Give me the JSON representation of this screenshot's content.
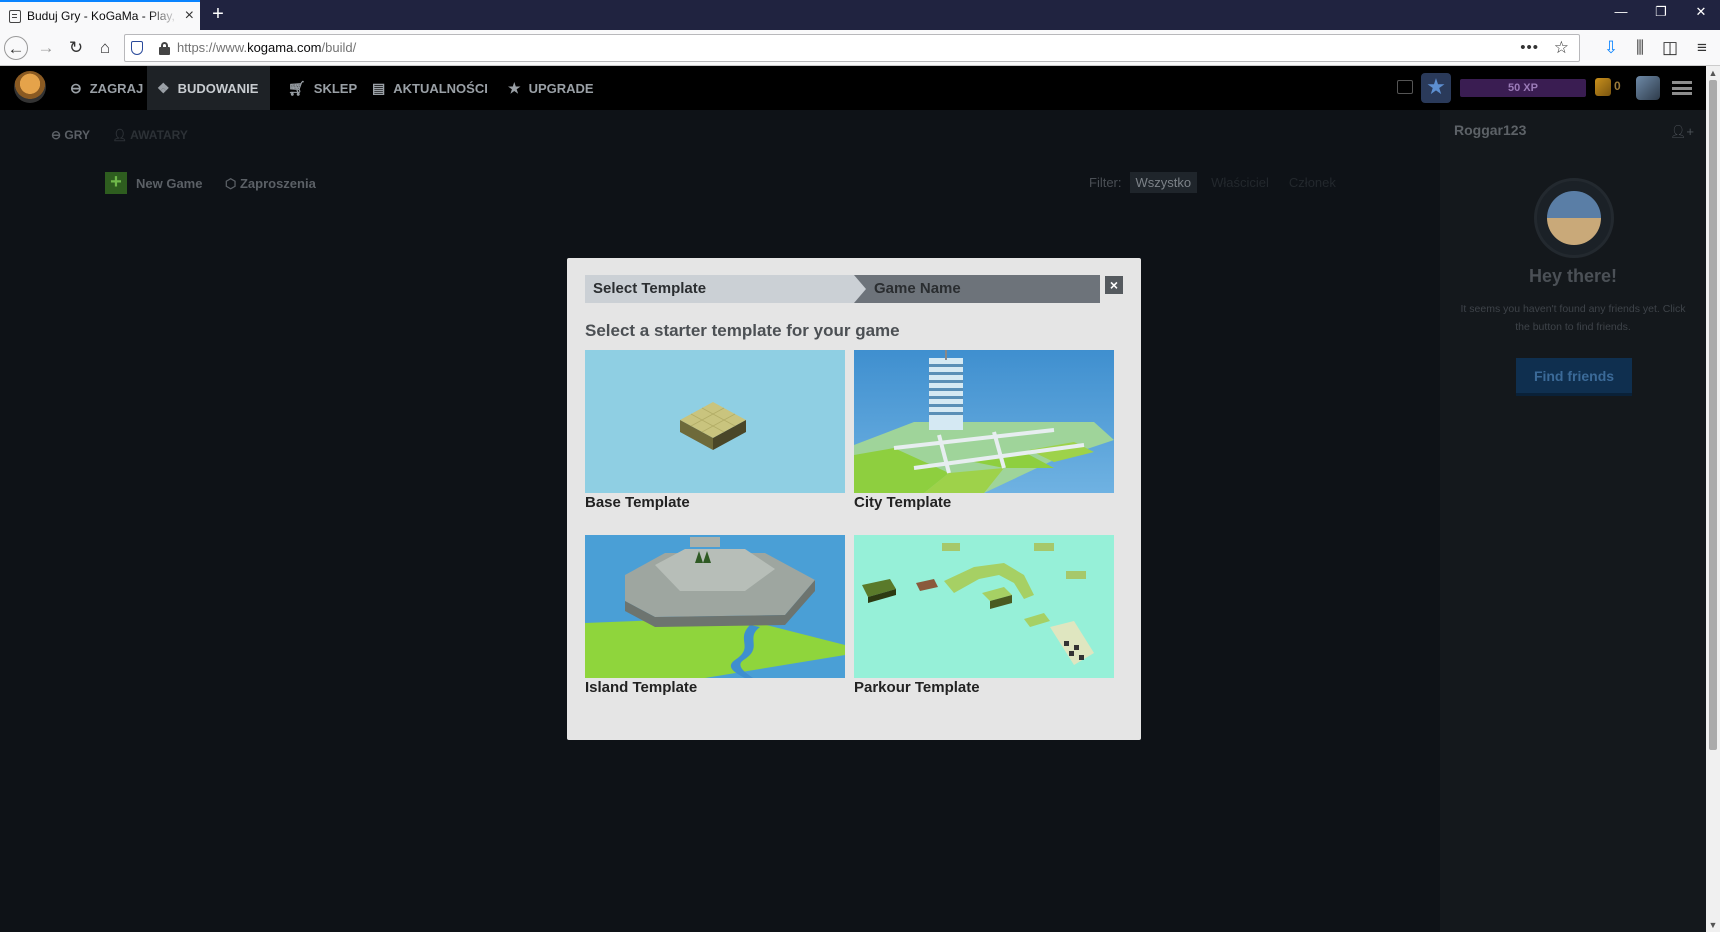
{
  "browser": {
    "tab_title": "Buduj Gry - KoGaMa - Play, Create And Share Multiplayer Games",
    "tab_close": "×",
    "new_tab": "+",
    "url_prefix": "https://www.",
    "url_domain": "kogama.com",
    "url_path": "/build/",
    "menu_dots": "•••"
  },
  "header": {
    "nav": [
      {
        "label": "ZAGRAJ",
        "icon": "gamepad-icon"
      },
      {
        "label": "BUDOWANIE",
        "icon": "cubes-icon"
      },
      {
        "label": "SKLEP",
        "icon": "cart-icon"
      },
      {
        "label": "AKTUALNOŚCI",
        "icon": "news-icon"
      },
      {
        "label": "UPGRADE",
        "icon": "star-icon"
      }
    ],
    "xp": "50 XP",
    "gold": "0"
  },
  "page": {
    "subnav": [
      {
        "label": "GRY",
        "icon": "gamepad-icon"
      },
      {
        "label": "AWATARY",
        "icon": "user-icon"
      }
    ],
    "new_game": "New Game",
    "invites": "Zaproszenia",
    "filter_label": "Filter:",
    "filters": [
      "Wszystko",
      "Właściciel",
      "Członek"
    ]
  },
  "sidebar": {
    "username": "Roggar123",
    "greeting": "Hey there!",
    "message": "It seems you haven't found any friends yet. Click the button to find friends.",
    "button": "Find friends"
  },
  "modal": {
    "step1": "Select Template",
    "step2": "Game Name",
    "close": "×",
    "heading": "Select a starter template for your game",
    "templates": [
      {
        "label": "Base Template"
      },
      {
        "label": "City Template"
      },
      {
        "label": "Island Template"
      },
      {
        "label": "Parkour Template"
      }
    ]
  }
}
